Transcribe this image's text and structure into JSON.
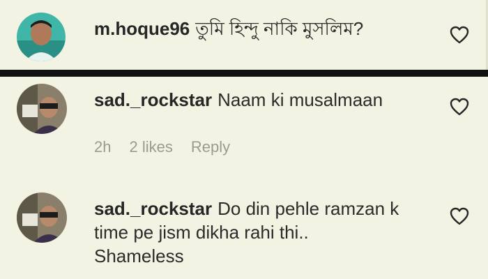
{
  "comments": [
    {
      "username": "m.hoque96",
      "text": "তুমি হিন্দু নাকি মুসলিম?"
    },
    {
      "username": "sad._rockstar",
      "text": "Naam ki musalmaan",
      "time": "2h",
      "likes": "2 likes",
      "reply": "Reply"
    },
    {
      "username": "sad._rockstar",
      "text_line1": "Do din pehle ramzan k",
      "text_line2": "time pe jism dikha rahi thi..",
      "text_line3": "Shameless"
    }
  ],
  "colors": {
    "panel_bg": "#f3f3e4",
    "divider": "#111111",
    "meta_gray": "#9b9b8c"
  },
  "icons": [
    "heart-icon",
    "avatar"
  ]
}
